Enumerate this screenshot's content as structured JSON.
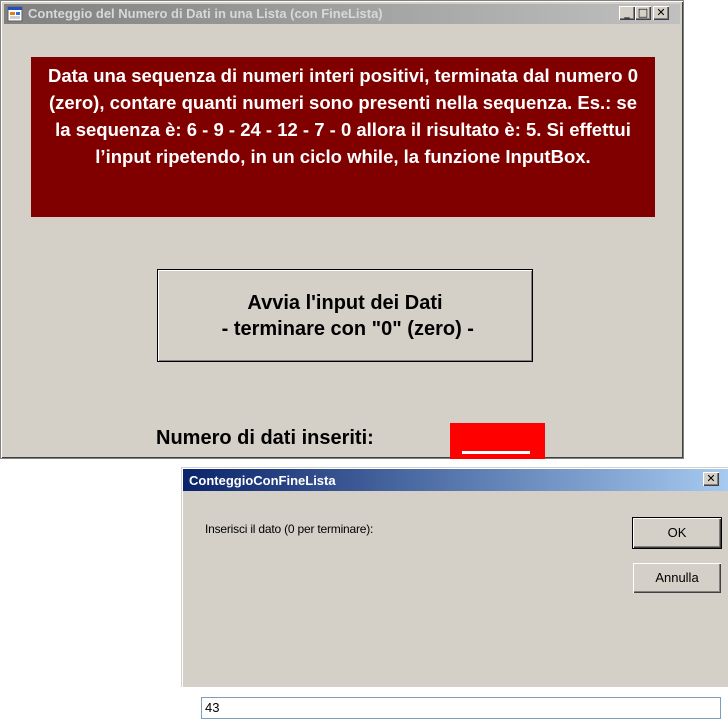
{
  "main_window": {
    "title": "Conteggio del Numero di Dati in una Lista (con FineLista)",
    "minimize_glyph": "_",
    "maximize_glyph": "□",
    "close_glyph": "✕",
    "description": "Data una sequenza di numeri interi positivi, terminata dal numero 0 (zero), contare quanti numeri sono presenti nella sequenza. Es.: se la sequenza è:  6 - 9 - 24 - 12 - 7 - 0  allora il risultato è: 5. Si effettui l’input ripetendo, in un ciclo while, la funzione InputBox.",
    "start_button": {
      "line1": "Avvia l'input dei Dati",
      "line2": " - terminare con \"0\" (zero) -"
    },
    "count_label": "Numero di dati inseriti:",
    "count_value": ""
  },
  "dialog": {
    "title": "ConteggioConFineLista",
    "close_glyph": "✕",
    "prompt": "Inserisci il dato (0 per terminare):",
    "ok_label": "OK",
    "cancel_label": "Annulla",
    "input_value": "43"
  },
  "colors": {
    "description_bg": "#800000",
    "count_box_bg": "#ff0000",
    "dialog_title_bg": "#0a246a",
    "window_bg": "#d4d0c8"
  },
  "icons": [
    "app-form-icon",
    "minimize-icon",
    "maximize-icon",
    "close-icon"
  ]
}
